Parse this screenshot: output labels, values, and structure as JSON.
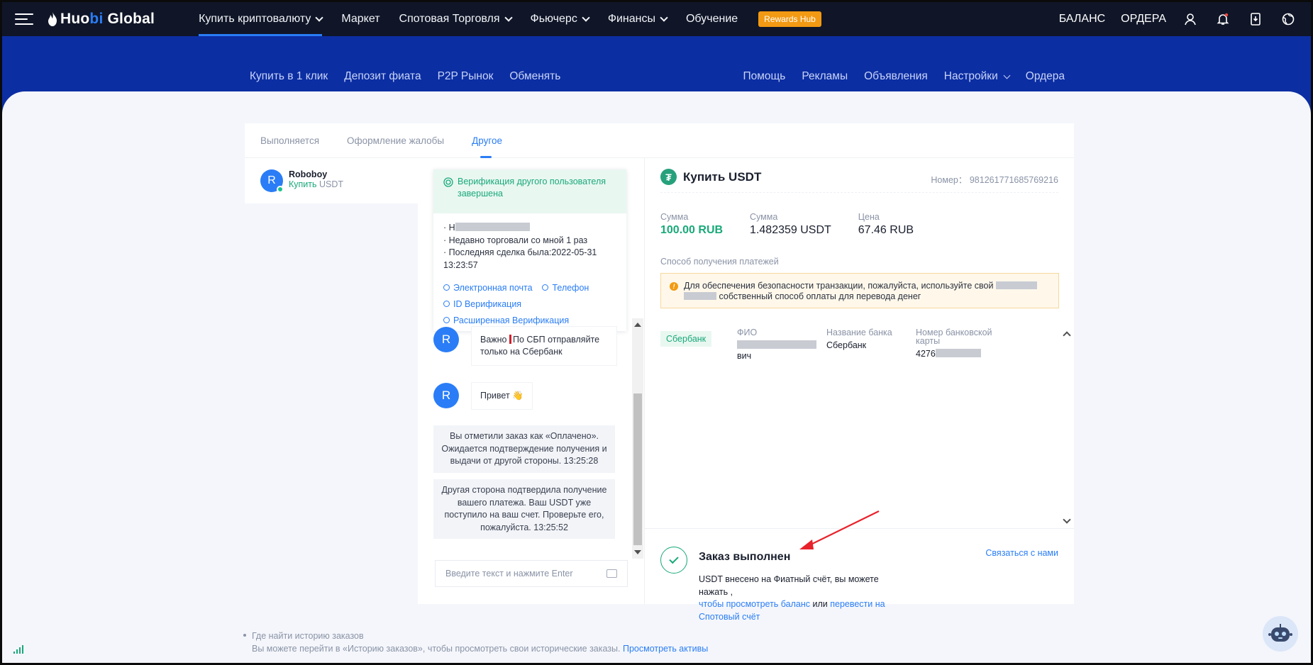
{
  "header": {
    "logo_text": "Huobi Global",
    "nav": [
      {
        "label": "Купить криптовалюту",
        "dropdown": true,
        "active": true
      },
      {
        "label": "Маркет",
        "dropdown": false
      },
      {
        "label": "Спотовая Торговля",
        "dropdown": true
      },
      {
        "label": "Фьючерс",
        "dropdown": true
      },
      {
        "label": "Финансы",
        "dropdown": true
      },
      {
        "label": "Обучение",
        "dropdown": false
      }
    ],
    "rewards_label": "Rewards Hub",
    "balance_label": "БАЛАНС",
    "orders_label": "ОРДЕРА",
    "icons": [
      "user-icon",
      "bell-icon",
      "download-icon",
      "globe-icon"
    ]
  },
  "subnav": {
    "left": [
      "Купить в 1 клик",
      "Депозит фиата",
      "P2P Рынок",
      "Обменять"
    ],
    "right": [
      "Помощь",
      "Рекламы",
      "Объявления",
      "Настройки",
      "Ордера"
    ]
  },
  "tabs": [
    "Выполняется",
    "Оформление жалобы",
    "Другое"
  ],
  "active_tab": 2,
  "chat_list": {
    "entry": {
      "avatar": "R",
      "name": "Roboboy",
      "action": "Купить",
      "asset": "USDT"
    }
  },
  "verification": {
    "header": "Верификация другого пользователя завершена",
    "name_prefix": "· Н",
    "traded": "· Недавно торговали со мной 1 раз",
    "last_trade": "· Последняя сделка была:2022-05-31 13:23:57",
    "links": [
      "Электронная почта",
      "Телефон",
      "ID Верификация",
      "Расширенная Верификация"
    ]
  },
  "messages": [
    {
      "avatar": "R",
      "text_a": "Важно ",
      "text_b": "По СБП отправляйте только на Сбербанк"
    },
    {
      "avatar": "R",
      "text": "Привет 👋"
    }
  ],
  "system_messages": [
    "Вы отметили заказ как «Оплачено». Ожидается подтверждение получения и выдачи от другой стороны. 13:25:28",
    "Другая сторона подтвердила получение вашего платежа. Ваш USDT уже поступило на ваш счет. Проверьте его, пожалуйста. 13:25:52"
  ],
  "chat_input": {
    "placeholder": "Введите текст и нажмите Enter"
  },
  "order": {
    "title": "Купить USDT",
    "number_label": "Номер：",
    "number": "9812617716857692​16",
    "amount_label": "Сумма",
    "amount": "100.00 RUB",
    "qty_label": "Сумма",
    "qty": "1.482359 USDT",
    "price_label": "Цена",
    "price": "67.46 RUB",
    "payment_method_label": "Способ получения платежей",
    "warning": {
      "text_a": "Для обеспечения безопасности транзакции, пожалуйста, используйте свой ",
      "text_b": " собственный способ оплаты для перевода денег"
    },
    "payment": {
      "bank_tag": "Сбербанк",
      "fio_label": "ФИО",
      "fio_value_end": "вич",
      "bank_name_label": "Название банка",
      "bank_name": "Сбербанк",
      "card_label": "Номер банковской карты",
      "card_prefix": "4276"
    },
    "done": {
      "title": "Заказ выполнен",
      "desc_a": "USDT внесено на Фиатный счёт, вы можете нажать ,",
      "link_a": "чтобы просмотреть баланс",
      "desc_b": " или ",
      "link_b": "перевести на Спотовый счёт"
    },
    "contact_label": "Связаться с нами"
  },
  "footer": {
    "line1": "Где найти историю заказов",
    "line2": "Вы можете перейти в «Историю заказов», чтобы просмотреть свои исторические заказы. ",
    "link": "Просмотреть активы"
  },
  "colors": {
    "nav_bg": "#101628",
    "band": "#0c2ea3",
    "accent": "#2a7df6",
    "green": "#19a979",
    "rewards": "#f29a13"
  }
}
